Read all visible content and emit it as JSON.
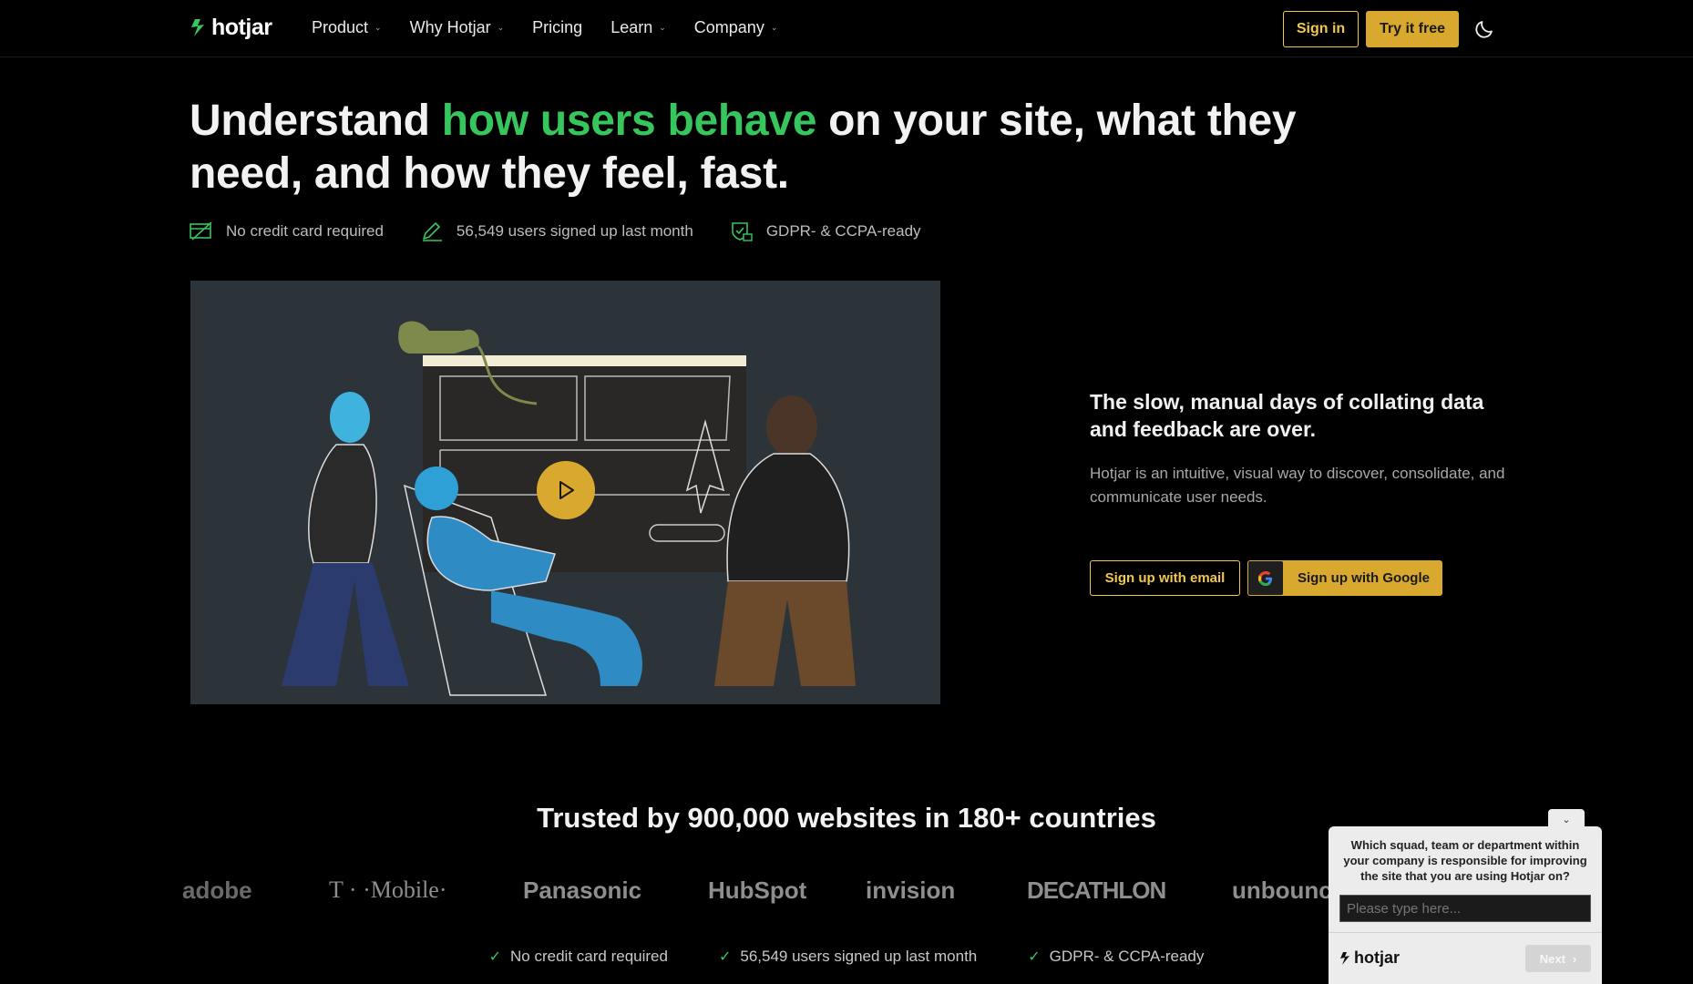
{
  "nav": {
    "logo_text": "hotjar",
    "items": [
      {
        "label": "Product",
        "has_dropdown": true
      },
      {
        "label": "Why Hotjar",
        "has_dropdown": true
      },
      {
        "label": "Pricing",
        "has_dropdown": false
      },
      {
        "label": "Learn",
        "has_dropdown": true
      },
      {
        "label": "Company",
        "has_dropdown": true
      }
    ],
    "signin_label": "Sign in",
    "try_label": "Try it free",
    "theme_icon": "moon-icon"
  },
  "hero": {
    "headline_pre": "Understand ",
    "headline_highlight": "how users behave",
    "headline_post": " on your site, what they need, and how they feel, fast.",
    "badges": [
      {
        "icon": "credit-card-icon",
        "text": "No credit card required"
      },
      {
        "icon": "pencil-icon",
        "text": "56,549 users signed up last month"
      },
      {
        "icon": "shield-lock-icon",
        "text": "GDPR- & CCPA-ready"
      }
    ],
    "side_title": "The slow, manual days of collating data and feedback are over.",
    "side_text": "Hotjar is an intuitive, visual way to discover, consolidate, and communicate user needs.",
    "email_button": "Sign up with email",
    "google_button": "Sign up with Google"
  },
  "trust": {
    "title": "Trusted by 900,000 websites in 180+ countries",
    "logos": [
      "adobe",
      "T · ·Mobile·",
      "Panasonic",
      "HubSpot",
      "invision",
      "DECATHLON",
      "unbounce"
    ],
    "checks": [
      "No credit card required",
      "56,549 users signed up last month",
      "GDPR- & CCPA-ready"
    ]
  },
  "survey": {
    "question": "Which squad, team or department within your company is responsible for improving the site that you are using Hotjar on?",
    "placeholder": "Please type here...",
    "logo_text": "hotjar",
    "next_label": "Next"
  },
  "colors": {
    "accent_green": "#37c65d",
    "accent_yellow": "#d9a82e",
    "background": "#000000"
  }
}
